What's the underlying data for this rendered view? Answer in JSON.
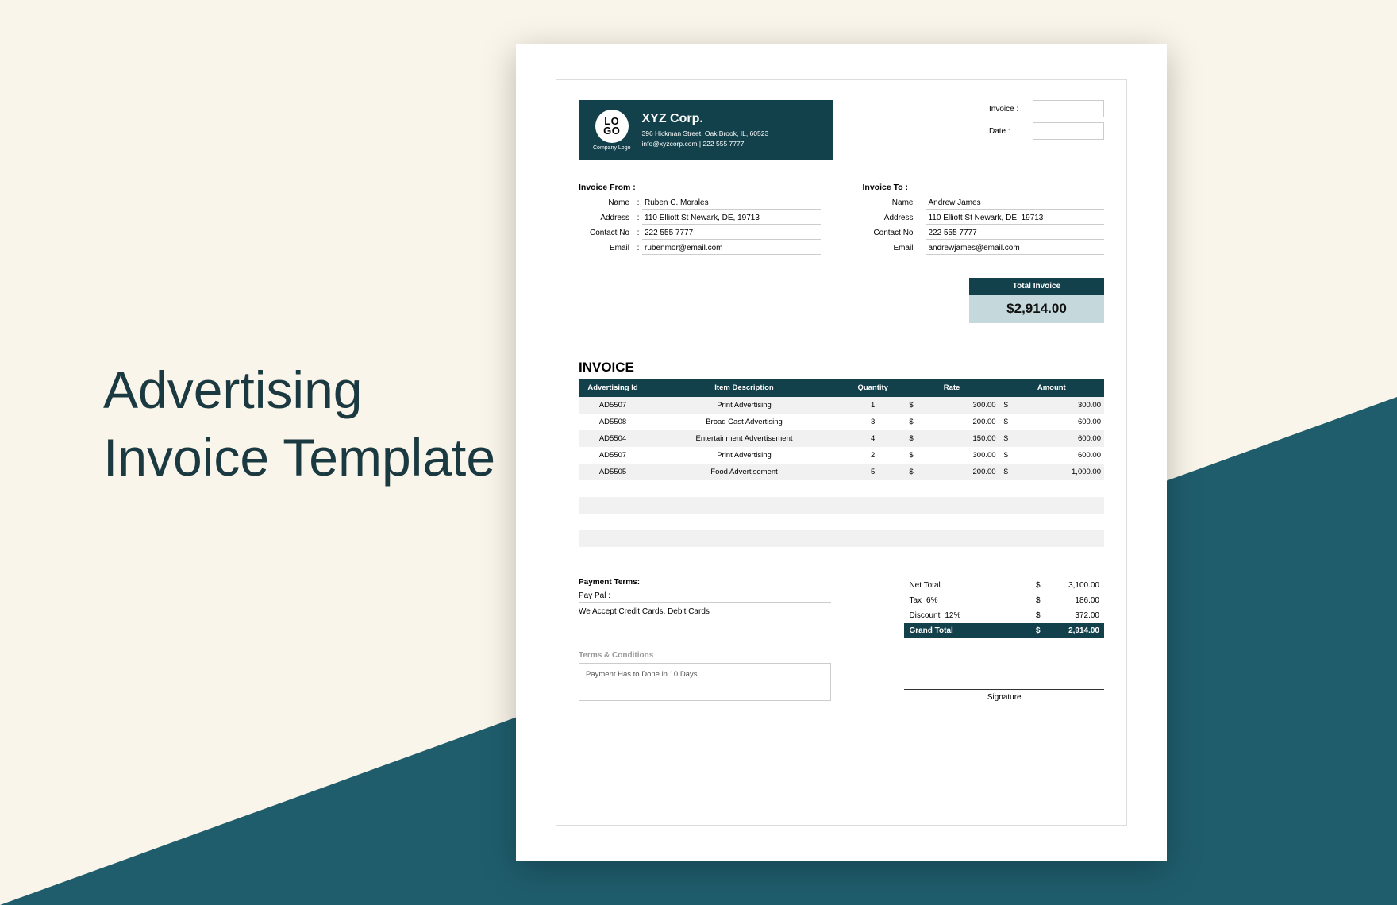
{
  "hero": {
    "title_line1": "Advertising",
    "title_line2": "Invoice Template"
  },
  "company": {
    "logo_text": "LO\nGO",
    "logo_caption": "Company Logo",
    "name": "XYZ Corp.",
    "address": "396 Hickman Street, Oak Brook, IL, 60523",
    "contact": "info@xyzcorp.com | 222 555 7777"
  },
  "meta": {
    "invoice_label": "Invoice :",
    "date_label": "Date :"
  },
  "from": {
    "heading": "Invoice From :",
    "name_label": "Name",
    "name": "Ruben C. Morales",
    "address_label": "Address",
    "address": "110 Elliott St Newark, DE, 19713",
    "contact_label": "Contact No",
    "contact": "222 555 7777",
    "email_label": "Email",
    "email": "rubenmor@email.com"
  },
  "to": {
    "heading": "Invoice To :",
    "name_label": "Name",
    "name": "Andrew James",
    "address_label": "Address",
    "address": "110 Elliott St Newark, DE, 19713",
    "contact_label": "Contact No",
    "contact": "222 555 7777",
    "email_label": "Email",
    "email": "andrewjames@email.com"
  },
  "total_box": {
    "label": "Total Invoice",
    "value": "$2,914.00"
  },
  "invoice_heading": "INVOICE",
  "table": {
    "headers": {
      "c1": "Advertising Id",
      "c2": "Item Description",
      "c3": "Quantity",
      "c4": "Rate",
      "c5": "Amount"
    },
    "currency": "$",
    "rows": [
      {
        "id": "AD5507",
        "desc": "Print Advertising",
        "qty": "1",
        "rate": "300.00",
        "amount": "300.00"
      },
      {
        "id": "AD5508",
        "desc": "Broad Cast Advertising",
        "qty": "3",
        "rate": "200.00",
        "amount": "600.00"
      },
      {
        "id": "AD5504",
        "desc": "Entertainment Advertisement",
        "qty": "4",
        "rate": "150.00",
        "amount": "600.00"
      },
      {
        "id": "AD5507",
        "desc": "Print Advertising",
        "qty": "2",
        "rate": "300.00",
        "amount": "600.00"
      },
      {
        "id": "AD5505",
        "desc": "Food Advertisement",
        "qty": "5",
        "rate": "200.00",
        "amount": "1,000.00"
      }
    ],
    "blank_rows": 5
  },
  "payment": {
    "heading": "Payment Terms:",
    "paypal_label": "Pay Pal  :",
    "accept": "We Accept Credit Cards, Debit Cards"
  },
  "summary": {
    "currency": "$",
    "net_label": "Net Total",
    "net": "3,100.00",
    "tax_label": "Tax",
    "tax_pct": "6%",
    "tax": "186.00",
    "discount_label": "Discount",
    "discount_pct": "12%",
    "discount": "372.00",
    "grand_label": "Grand Total",
    "grand": "2,914.00"
  },
  "terms": {
    "heading": "Terms & Conditions",
    "body": "Payment Has to Done in 10 Days"
  },
  "signature": {
    "label": "Signature"
  }
}
